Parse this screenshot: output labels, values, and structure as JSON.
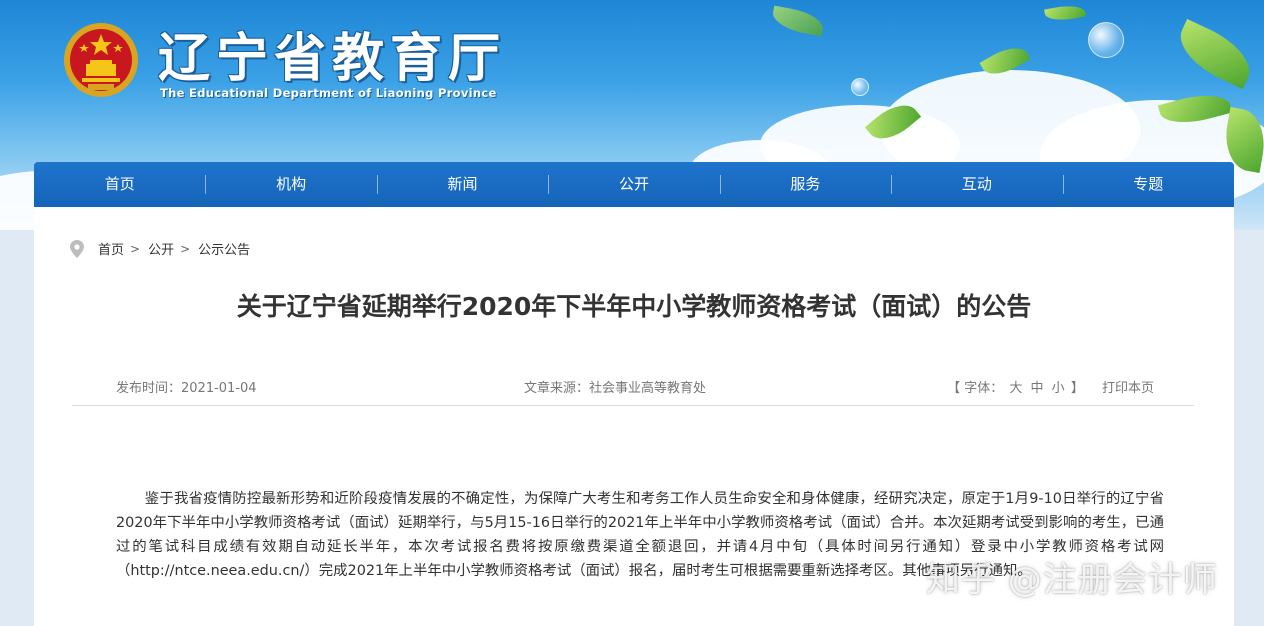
{
  "header": {
    "title": "辽宁省教育厅",
    "subtitle": "The Educational Department of Liaoning Province"
  },
  "nav": {
    "items": [
      "首页",
      "机构",
      "新闻",
      "公开",
      "服务",
      "互动",
      "专题"
    ]
  },
  "breadcrumb": {
    "items": [
      "首页",
      "公开",
      "公示公告"
    ],
    "separator": ">"
  },
  "article": {
    "title": "关于辽宁省延期举行2020年下半年中小学教师资格考试（面试）的公告",
    "publish_label": "发布时间：",
    "publish_date": "2021-01-04",
    "source_label": "文章来源：",
    "source": "社会事业高等教育处",
    "font_label": "【 字体：",
    "font_large": "大",
    "font_medium": "中",
    "font_small": "小",
    "font_close": "】",
    "print_label": "打印本页",
    "body": "鉴于我省疫情防控最新形势和近阶段疫情发展的不确定性，为保障广大考生和考务工作人员生命安全和身体健康，经研究决定，原定于1月9-10日举行的辽宁省2020年下半年中小学教师资格考试（面试）延期举行，与5月15-16日举行的2021年上半年中小学教师资格考试（面试）合并。本次延期考试受到影响的考生，已通过的笔试科目成绩有效期自动延长半年，本次考试报名费将按原缴费渠道全额退回，并请4月中旬（具体时间另行通知）登录中小学教师资格考试网（http://ntce.neea.edu.cn/）完成2021年上半年中小学教师资格考试（面试）报名，届时考生可根据需要重新选择考区。其他事项另行通知。"
  },
  "watermark": "知乎 @注册会计师",
  "colors": {
    "nav_blue": "#1564b9",
    "sky_blue": "#3aa1e6",
    "text": "#333333"
  }
}
